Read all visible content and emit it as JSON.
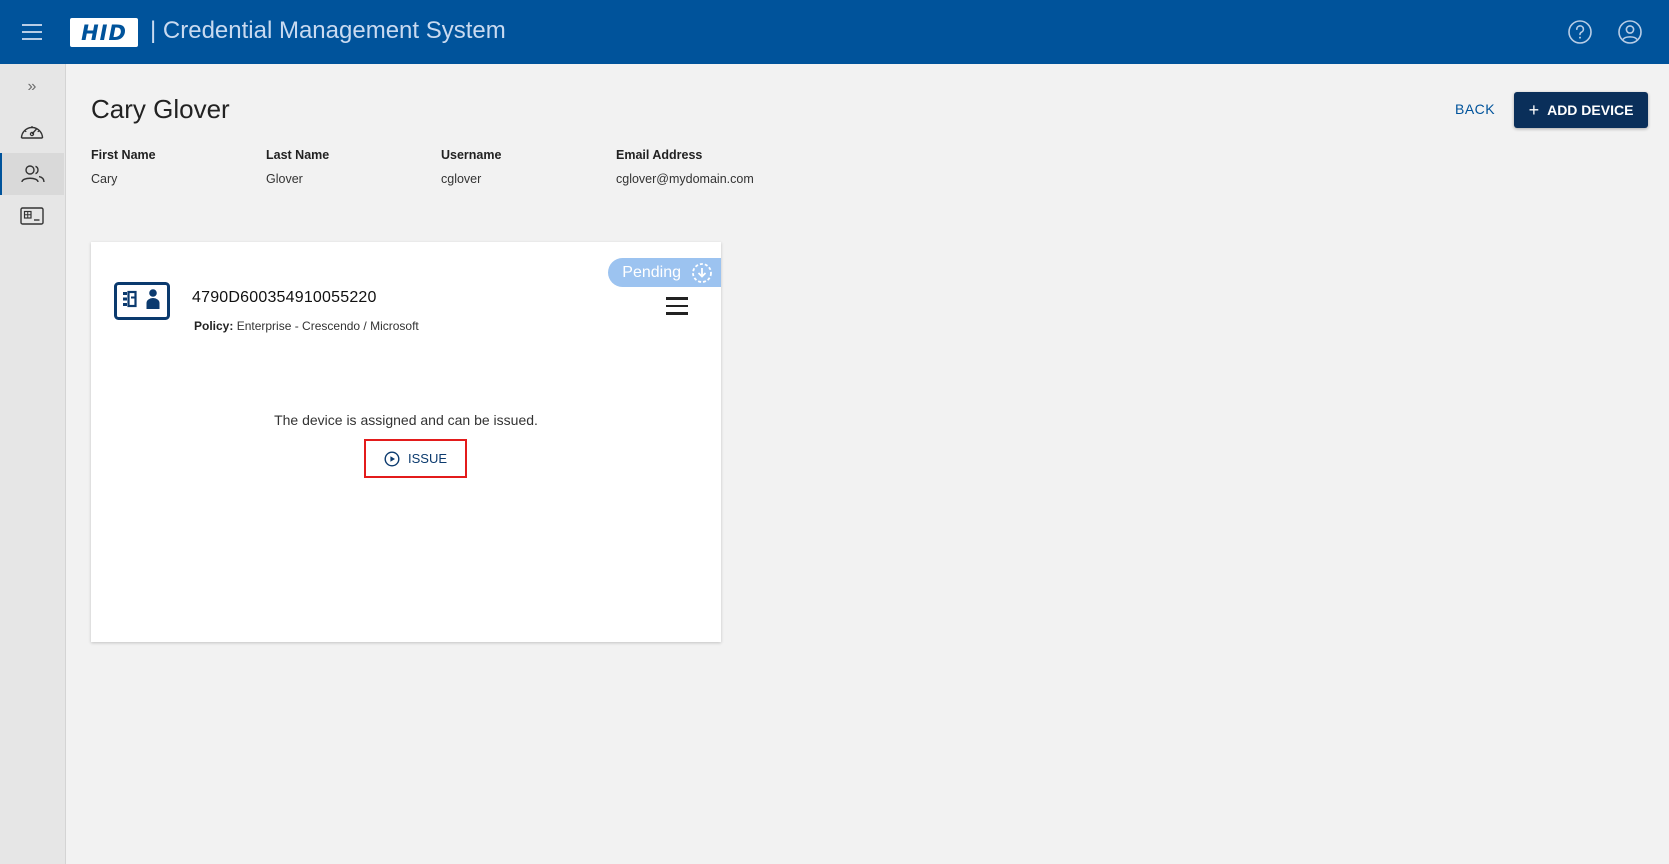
{
  "header": {
    "logo_text": "HID",
    "app_title": "| Credential Management System",
    "icons": [
      "menu-icon",
      "help-icon",
      "account-icon"
    ],
    "brand_color": "#00539b"
  },
  "sidebar": {
    "expand_label": "»",
    "items": [
      {
        "icon": "dashboard-icon",
        "active": false
      },
      {
        "icon": "users-icon",
        "active": true
      },
      {
        "icon": "card-reader-icon",
        "active": false
      }
    ]
  },
  "page": {
    "title": "Cary Glover",
    "back_label": "BACK",
    "add_device_label": "ADD DEVICE"
  },
  "user": {
    "first_name_label": "First Name",
    "first_name": "Cary",
    "last_name_label": "Last Name",
    "last_name": "Glover",
    "username_label": "Username",
    "username": "cglover",
    "email_label": "Email Address",
    "email": "cglover@mydomain.com"
  },
  "device": {
    "status": "Pending",
    "status_color": "#9cc3f0",
    "serial": "4790D600354910055220",
    "policy_label": "Policy:",
    "policy_value": "Enterprise - Crescendo / Microsoft",
    "message": "The device is assigned and can be issued.",
    "issue_label": "ISSUE"
  }
}
